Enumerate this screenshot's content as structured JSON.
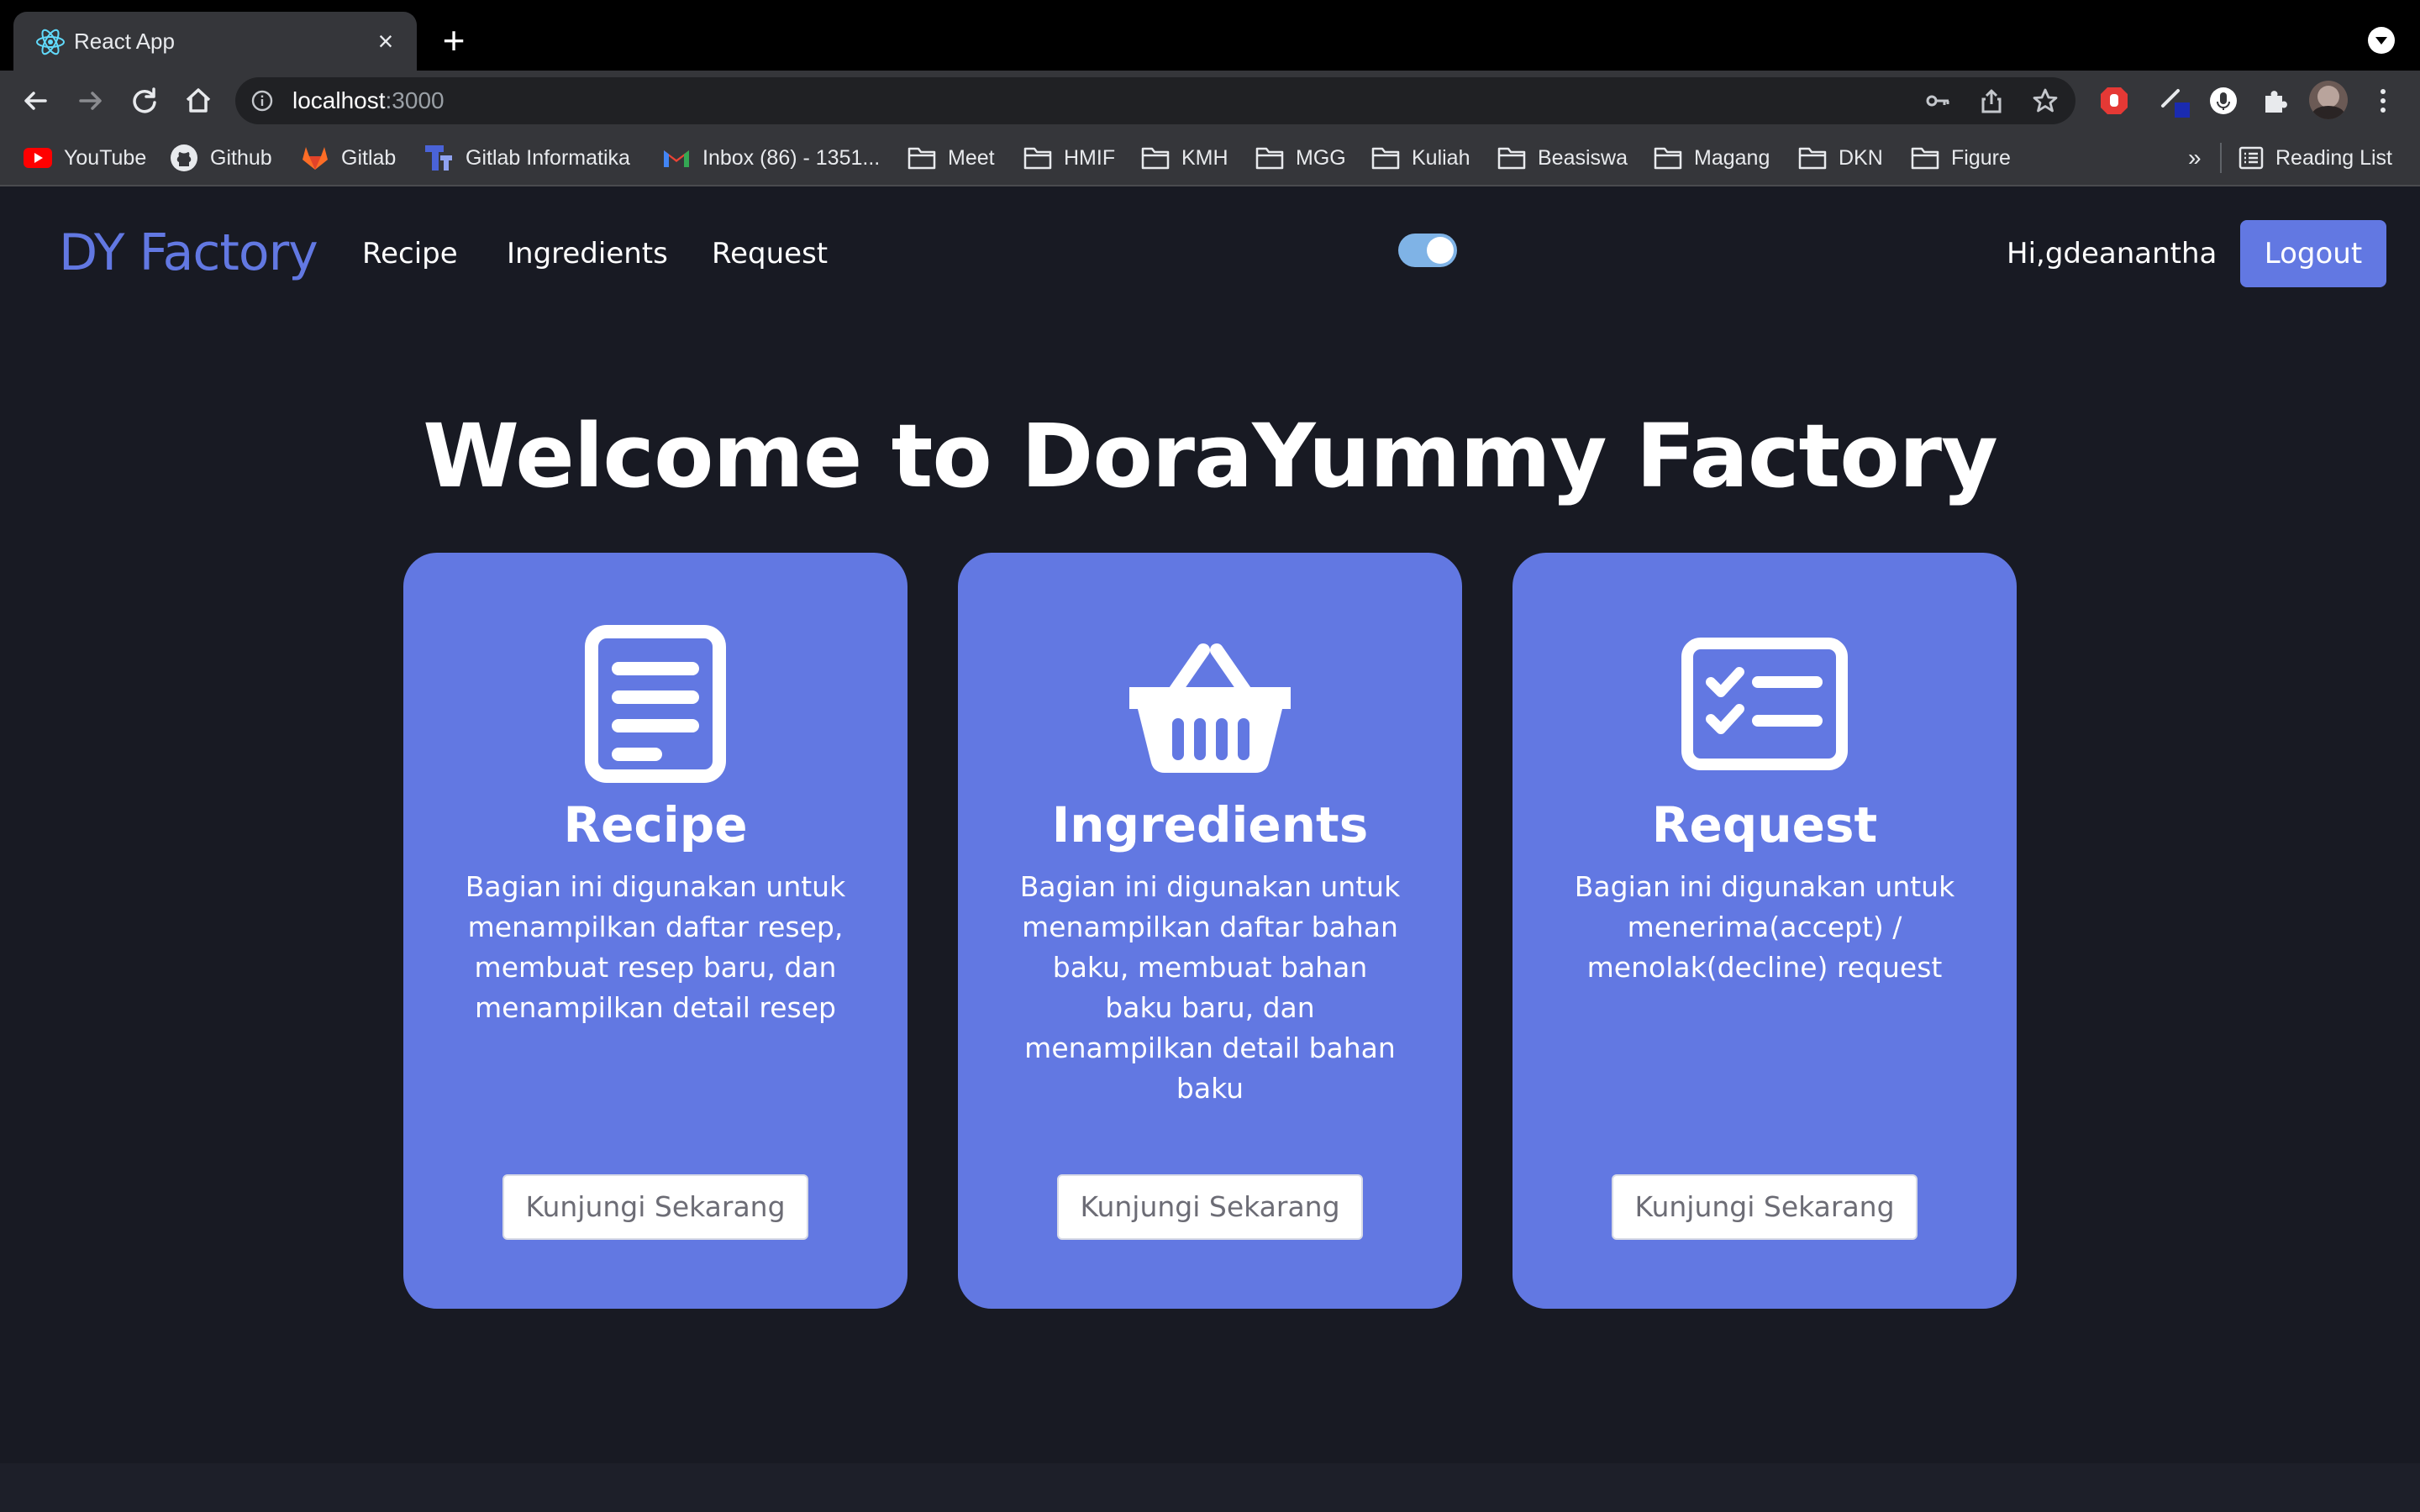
{
  "browser": {
    "tab_title": "React App",
    "tab_close": "×",
    "new_tab": "+",
    "url_host": "localhost",
    "url_port": ":3000",
    "bookmarks": [
      {
        "label": "YouTube",
        "icon": "youtube-icon"
      },
      {
        "label": "Github",
        "icon": "github-icon"
      },
      {
        "label": "Gitlab",
        "icon": "gitlab-icon"
      },
      {
        "label": "Gitlab Informatika",
        "icon": "gitlab-informatika-icon"
      },
      {
        "label": "Inbox (86) - 1351...",
        "icon": "gmail-icon"
      },
      {
        "label": "Meet",
        "icon": "folder-icon"
      },
      {
        "label": "HMIF",
        "icon": "folder-icon"
      },
      {
        "label": "KMH",
        "icon": "folder-icon"
      },
      {
        "label": "MGG",
        "icon": "folder-icon"
      },
      {
        "label": "Kuliah",
        "icon": "folder-icon"
      },
      {
        "label": "Beasiswa",
        "icon": "folder-icon"
      },
      {
        "label": "Magang",
        "icon": "folder-icon"
      },
      {
        "label": "DKN",
        "icon": "folder-icon"
      },
      {
        "label": "Figure",
        "icon": "folder-icon"
      }
    ],
    "overflow": "»",
    "reading_list": "Reading List"
  },
  "navbar": {
    "brand": "DY Factory",
    "links": [
      "Recipe",
      "Ingredients",
      "Request"
    ],
    "greeting": "Hi,gdeanantha",
    "logout": "Logout",
    "theme_toggle_on": true
  },
  "main": {
    "heading": "Welcome to DoraYummy Factory",
    "cards": [
      {
        "title": "Recipe",
        "description": "Bagian ini digunakan untuk menampilkan daftar resep, membuat resep baru, dan menampilkan detail resep",
        "button": "Kunjungi Sekarang",
        "icon": "document-icon"
      },
      {
        "title": "Ingredients",
        "description": "Bagian ini digunakan untuk menampilkan daftar bahan baku, membuat bahan baku baru, dan menampilkan detail bahan baku",
        "button": "Kunjungi Sekarang",
        "icon": "basket-icon"
      },
      {
        "title": "Request",
        "description": "Bagian ini digunakan untuk menerima(accept) / menolak(decline) request",
        "button": "Kunjungi Sekarang",
        "icon": "checklist-icon"
      }
    ]
  },
  "colors": {
    "accent": "#6278e2",
    "background": "#181a23"
  }
}
